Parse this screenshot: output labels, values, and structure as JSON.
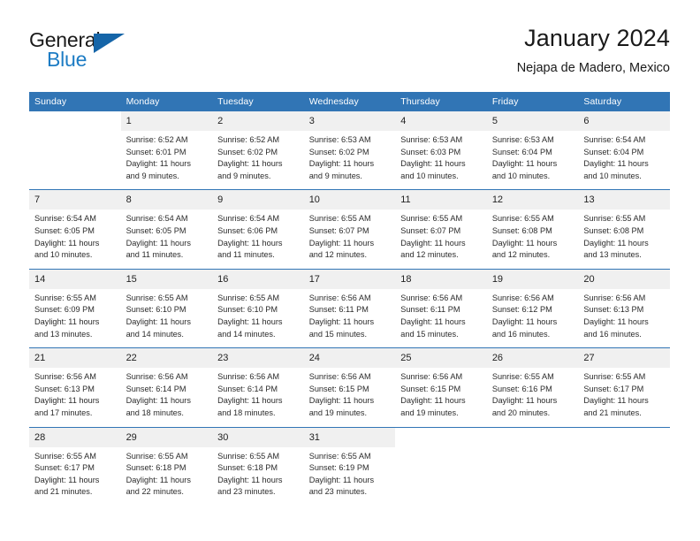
{
  "brand": {
    "name_part1": "General",
    "name_part2": "Blue",
    "triangle_color": "#1565a8",
    "blue_text_color": "#1d7cc4"
  },
  "header": {
    "title": "January 2024",
    "subtitle": "Nejapa de Madero, Mexico",
    "accent_color": "#3175b5",
    "daynum_band_color": "#f0f0f0"
  },
  "weekday_headers": [
    "Sunday",
    "Monday",
    "Tuesday",
    "Wednesday",
    "Thursday",
    "Friday",
    "Saturday"
  ],
  "weeks": [
    {
      "days": [
        {
          "date": "",
          "sunrise": "",
          "sunset": "",
          "daylight1": "",
          "daylight2": "",
          "empty": true
        },
        {
          "date": "1",
          "sunrise": "Sunrise: 6:52 AM",
          "sunset": "Sunset: 6:01 PM",
          "daylight1": "Daylight: 11 hours",
          "daylight2": "and 9 minutes.",
          "empty": false
        },
        {
          "date": "2",
          "sunrise": "Sunrise: 6:52 AM",
          "sunset": "Sunset: 6:02 PM",
          "daylight1": "Daylight: 11 hours",
          "daylight2": "and 9 minutes.",
          "empty": false
        },
        {
          "date": "3",
          "sunrise": "Sunrise: 6:53 AM",
          "sunset": "Sunset: 6:02 PM",
          "daylight1": "Daylight: 11 hours",
          "daylight2": "and 9 minutes.",
          "empty": false
        },
        {
          "date": "4",
          "sunrise": "Sunrise: 6:53 AM",
          "sunset": "Sunset: 6:03 PM",
          "daylight1": "Daylight: 11 hours",
          "daylight2": "and 10 minutes.",
          "empty": false
        },
        {
          "date": "5",
          "sunrise": "Sunrise: 6:53 AM",
          "sunset": "Sunset: 6:04 PM",
          "daylight1": "Daylight: 11 hours",
          "daylight2": "and 10 minutes.",
          "empty": false
        },
        {
          "date": "6",
          "sunrise": "Sunrise: 6:54 AM",
          "sunset": "Sunset: 6:04 PM",
          "daylight1": "Daylight: 11 hours",
          "daylight2": "and 10 minutes.",
          "empty": false
        }
      ]
    },
    {
      "days": [
        {
          "date": "7",
          "sunrise": "Sunrise: 6:54 AM",
          "sunset": "Sunset: 6:05 PM",
          "daylight1": "Daylight: 11 hours",
          "daylight2": "and 10 minutes.",
          "empty": false
        },
        {
          "date": "8",
          "sunrise": "Sunrise: 6:54 AM",
          "sunset": "Sunset: 6:05 PM",
          "daylight1": "Daylight: 11 hours",
          "daylight2": "and 11 minutes.",
          "empty": false
        },
        {
          "date": "9",
          "sunrise": "Sunrise: 6:54 AM",
          "sunset": "Sunset: 6:06 PM",
          "daylight1": "Daylight: 11 hours",
          "daylight2": "and 11 minutes.",
          "empty": false
        },
        {
          "date": "10",
          "sunrise": "Sunrise: 6:55 AM",
          "sunset": "Sunset: 6:07 PM",
          "daylight1": "Daylight: 11 hours",
          "daylight2": "and 12 minutes.",
          "empty": false
        },
        {
          "date": "11",
          "sunrise": "Sunrise: 6:55 AM",
          "sunset": "Sunset: 6:07 PM",
          "daylight1": "Daylight: 11 hours",
          "daylight2": "and 12 minutes.",
          "empty": false
        },
        {
          "date": "12",
          "sunrise": "Sunrise: 6:55 AM",
          "sunset": "Sunset: 6:08 PM",
          "daylight1": "Daylight: 11 hours",
          "daylight2": "and 12 minutes.",
          "empty": false
        },
        {
          "date": "13",
          "sunrise": "Sunrise: 6:55 AM",
          "sunset": "Sunset: 6:08 PM",
          "daylight1": "Daylight: 11 hours",
          "daylight2": "and 13 minutes.",
          "empty": false
        }
      ]
    },
    {
      "days": [
        {
          "date": "14",
          "sunrise": "Sunrise: 6:55 AM",
          "sunset": "Sunset: 6:09 PM",
          "daylight1": "Daylight: 11 hours",
          "daylight2": "and 13 minutes.",
          "empty": false
        },
        {
          "date": "15",
          "sunrise": "Sunrise: 6:55 AM",
          "sunset": "Sunset: 6:10 PM",
          "daylight1": "Daylight: 11 hours",
          "daylight2": "and 14 minutes.",
          "empty": false
        },
        {
          "date": "16",
          "sunrise": "Sunrise: 6:55 AM",
          "sunset": "Sunset: 6:10 PM",
          "daylight1": "Daylight: 11 hours",
          "daylight2": "and 14 minutes.",
          "empty": false
        },
        {
          "date": "17",
          "sunrise": "Sunrise: 6:56 AM",
          "sunset": "Sunset: 6:11 PM",
          "daylight1": "Daylight: 11 hours",
          "daylight2": "and 15 minutes.",
          "empty": false
        },
        {
          "date": "18",
          "sunrise": "Sunrise: 6:56 AM",
          "sunset": "Sunset: 6:11 PM",
          "daylight1": "Daylight: 11 hours",
          "daylight2": "and 15 minutes.",
          "empty": false
        },
        {
          "date": "19",
          "sunrise": "Sunrise: 6:56 AM",
          "sunset": "Sunset: 6:12 PM",
          "daylight1": "Daylight: 11 hours",
          "daylight2": "and 16 minutes.",
          "empty": false
        },
        {
          "date": "20",
          "sunrise": "Sunrise: 6:56 AM",
          "sunset": "Sunset: 6:13 PM",
          "daylight1": "Daylight: 11 hours",
          "daylight2": "and 16 minutes.",
          "empty": false
        }
      ]
    },
    {
      "days": [
        {
          "date": "21",
          "sunrise": "Sunrise: 6:56 AM",
          "sunset": "Sunset: 6:13 PM",
          "daylight1": "Daylight: 11 hours",
          "daylight2": "and 17 minutes.",
          "empty": false
        },
        {
          "date": "22",
          "sunrise": "Sunrise: 6:56 AM",
          "sunset": "Sunset: 6:14 PM",
          "daylight1": "Daylight: 11 hours",
          "daylight2": "and 18 minutes.",
          "empty": false
        },
        {
          "date": "23",
          "sunrise": "Sunrise: 6:56 AM",
          "sunset": "Sunset: 6:14 PM",
          "daylight1": "Daylight: 11 hours",
          "daylight2": "and 18 minutes.",
          "empty": false
        },
        {
          "date": "24",
          "sunrise": "Sunrise: 6:56 AM",
          "sunset": "Sunset: 6:15 PM",
          "daylight1": "Daylight: 11 hours",
          "daylight2": "and 19 minutes.",
          "empty": false
        },
        {
          "date": "25",
          "sunrise": "Sunrise: 6:56 AM",
          "sunset": "Sunset: 6:15 PM",
          "daylight1": "Daylight: 11 hours",
          "daylight2": "and 19 minutes.",
          "empty": false
        },
        {
          "date": "26",
          "sunrise": "Sunrise: 6:55 AM",
          "sunset": "Sunset: 6:16 PM",
          "daylight1": "Daylight: 11 hours",
          "daylight2": "and 20 minutes.",
          "empty": false
        },
        {
          "date": "27",
          "sunrise": "Sunrise: 6:55 AM",
          "sunset": "Sunset: 6:17 PM",
          "daylight1": "Daylight: 11 hours",
          "daylight2": "and 21 minutes.",
          "empty": false
        }
      ]
    },
    {
      "days": [
        {
          "date": "28",
          "sunrise": "Sunrise: 6:55 AM",
          "sunset": "Sunset: 6:17 PM",
          "daylight1": "Daylight: 11 hours",
          "daylight2": "and 21 minutes.",
          "empty": false
        },
        {
          "date": "29",
          "sunrise": "Sunrise: 6:55 AM",
          "sunset": "Sunset: 6:18 PM",
          "daylight1": "Daylight: 11 hours",
          "daylight2": "and 22 minutes.",
          "empty": false
        },
        {
          "date": "30",
          "sunrise": "Sunrise: 6:55 AM",
          "sunset": "Sunset: 6:18 PM",
          "daylight1": "Daylight: 11 hours",
          "daylight2": "and 23 minutes.",
          "empty": false
        },
        {
          "date": "31",
          "sunrise": "Sunrise: 6:55 AM",
          "sunset": "Sunset: 6:19 PM",
          "daylight1": "Daylight: 11 hours",
          "daylight2": "and 23 minutes.",
          "empty": false
        },
        {
          "date": "",
          "sunrise": "",
          "sunset": "",
          "daylight1": "",
          "daylight2": "",
          "empty": true
        },
        {
          "date": "",
          "sunrise": "",
          "sunset": "",
          "daylight1": "",
          "daylight2": "",
          "empty": true
        },
        {
          "date": "",
          "sunrise": "",
          "sunset": "",
          "daylight1": "",
          "daylight2": "",
          "empty": true
        }
      ]
    }
  ]
}
